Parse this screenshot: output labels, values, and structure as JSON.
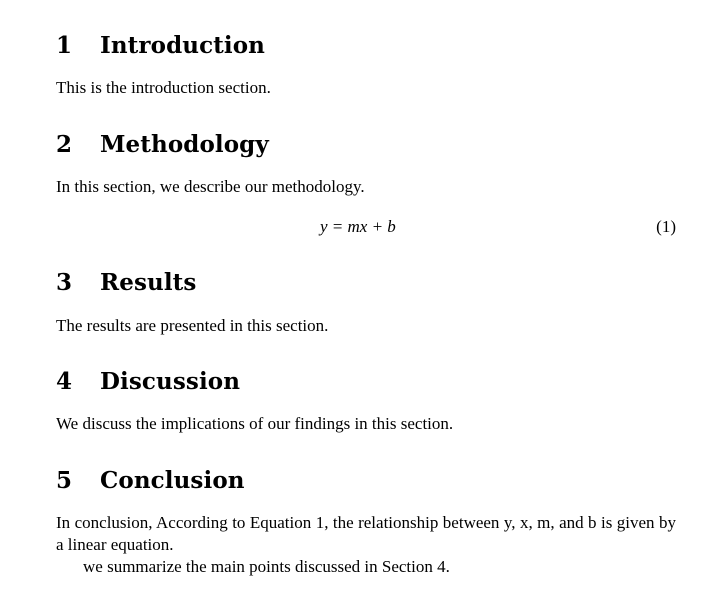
{
  "document": {
    "sections": [
      {
        "number": "1",
        "title": "Introduction",
        "body": "This is the introduction section."
      },
      {
        "number": "2",
        "title": "Methodology",
        "body": "In this section, we describe our methodology.",
        "equation": {
          "text": "y = mx + b",
          "label": "(1)"
        }
      },
      {
        "number": "3",
        "title": "Results",
        "body": "The results are presented in this section."
      },
      {
        "number": "4",
        "title": "Discussion",
        "body": "We discuss the implications of our findings in this section."
      },
      {
        "number": "5",
        "title": "Conclusion",
        "body_line1": "In conclusion, According to Equation 1, the relationship between y, x, m, and b is given by a linear equation.",
        "body_line2": "we summarize the main points discussed in Section 4."
      }
    ]
  }
}
